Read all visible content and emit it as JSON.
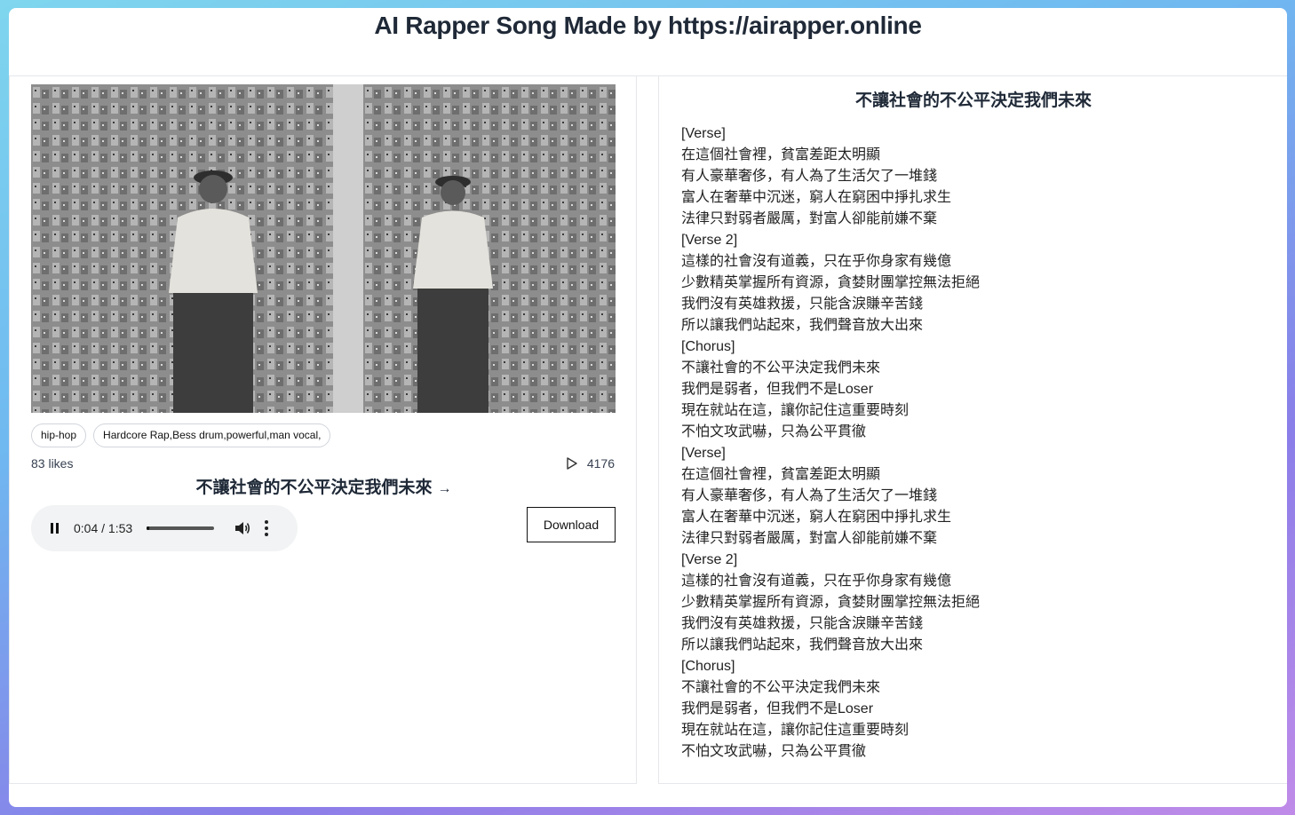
{
  "header": {
    "title": "AI Rapper Song Made by https://airapper.online"
  },
  "song": {
    "cover_alt": "Album cover illustration",
    "tags": [
      "hip-hop",
      "Hardcore Rap,Bess drum,powerful,man vocal,"
    ],
    "likes": "83 likes",
    "plays": "4176",
    "title": "不讓社會的不公平決定我們未來",
    "title_arrow": "→",
    "player": {
      "current_time": "0:04",
      "separator": "/",
      "duration": "1:53",
      "progress": 0.035,
      "state": "playing"
    },
    "download_label": "Download"
  },
  "lyrics": {
    "title": "不讓社會的不公平決定我們未來",
    "lines": [
      "[Verse]",
      "在這個社會裡，貧富差距太明顯",
      "有人豪華奢侈，有人為了生活欠了一堆錢",
      "富人在奢華中沉迷，窮人在窮困中掙扎求生",
      "法律只對弱者嚴厲，對富人卻能前嫌不棄",
      "[Verse 2]",
      "這樣的社會沒有道義，只在乎你身家有幾億",
      "少數精英掌握所有資源，貪婪財團掌控無法拒絕",
      "我們沒有英雄救援，只能含淚賺辛苦錢",
      "所以讓我們站起來，我們聲音放大出來",
      "[Chorus]",
      "不讓社會的不公平決定我們未來",
      "我們是弱者，但我們不是Loser",
      "現在就站在這，讓你記住這重要時刻",
      "不怕文攻武嚇，只為公平貫徹",
      "[Verse]",
      "在這個社會裡，貧富差距太明顯",
      "有人豪華奢侈，有人為了生活欠了一堆錢",
      "富人在奢華中沉迷，窮人在窮困中掙扎求生",
      "法律只對弱者嚴厲，對富人卻能前嫌不棄",
      "[Verse 2]",
      "這樣的社會沒有道義，只在乎你身家有幾億",
      "少數精英掌握所有資源，貪婪財團掌控無法拒絕",
      "我們沒有英雄救援，只能含淚賺辛苦錢",
      "所以讓我們站起來，我們聲音放大出來",
      "[Chorus]",
      "不讓社會的不公平決定我們未來",
      "我們是弱者，但我們不是Loser",
      "現在就站在這，讓你記住這重要時刻",
      "不怕文攻武嚇，只為公平貫徹"
    ]
  },
  "colors": {
    "accent_text": "#1f2937",
    "player_bg": "#f1f3f4",
    "border": "#e5e7eb"
  }
}
